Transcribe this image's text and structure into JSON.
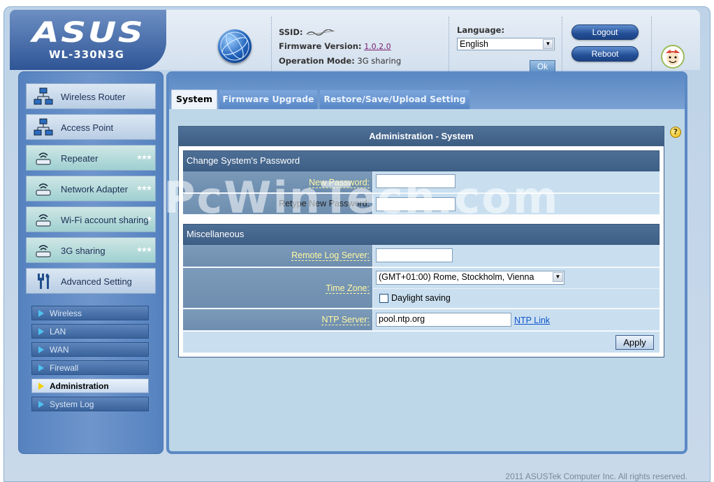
{
  "header": {
    "brand_logo": "ASUS",
    "model": "WL-330N3G",
    "ssid_label": "SSID:",
    "firmware_label": "Firmware Version:",
    "firmware_version": "1.0.2.0",
    "opmode_label": "Operation Mode:",
    "opmode_value": "3G sharing",
    "language_label": "Language:",
    "language_value": "English",
    "ok_label": "Ok",
    "logout_label": "Logout",
    "reboot_label": "Reboot"
  },
  "sidebar": {
    "items": [
      {
        "label": "Wireless Router",
        "icon": "network-icon"
      },
      {
        "label": "Access Point",
        "icon": "network-icon"
      },
      {
        "label": "Repeater",
        "icon": "wifi-device-icon"
      },
      {
        "label": "Network Adapter",
        "icon": "wifi-device-icon"
      },
      {
        "label": "Wi-Fi account sharing",
        "icon": "wifi-device-icon"
      },
      {
        "label": "3G sharing",
        "icon": "wifi-device-icon"
      },
      {
        "label": "Advanced Setting",
        "icon": "wrench-icon"
      }
    ],
    "sub_items": [
      {
        "label": "Wireless"
      },
      {
        "label": "LAN"
      },
      {
        "label": "WAN"
      },
      {
        "label": "Firewall"
      },
      {
        "label": "Administration"
      },
      {
        "label": "System Log"
      }
    ]
  },
  "tabs": [
    {
      "label": "System"
    },
    {
      "label": "Firmware Upgrade"
    },
    {
      "label": "Restore/Save/Upload Setting"
    }
  ],
  "panel": {
    "title": "Administration - System",
    "password_section": "Change System's Password",
    "new_password_label": "New Password:",
    "new_password_value": "",
    "retype_password_label": "Retype New Password:",
    "retype_password_value": "",
    "misc_section": "Miscellaneous",
    "remote_log_label": "Remote Log Server:",
    "remote_log_value": "",
    "timezone_label": "Time Zone:",
    "timezone_value": "(GMT+01:00) Rome, Stockholm, Vienna",
    "daylight_label": "Daylight saving",
    "daylight_checked": false,
    "ntp_label": "NTP Server:",
    "ntp_value": "pool.ntp.org",
    "ntp_link": "NTP Link",
    "apply_label": "Apply"
  },
  "watermark": "PcWinTech.com",
  "footer": "2011 ASUSTek Computer Inc. All rights reserved.",
  "colors": {
    "accent": "#5b89c4",
    "label_text": "#fff8a0",
    "section_header": "#4e6f95"
  }
}
